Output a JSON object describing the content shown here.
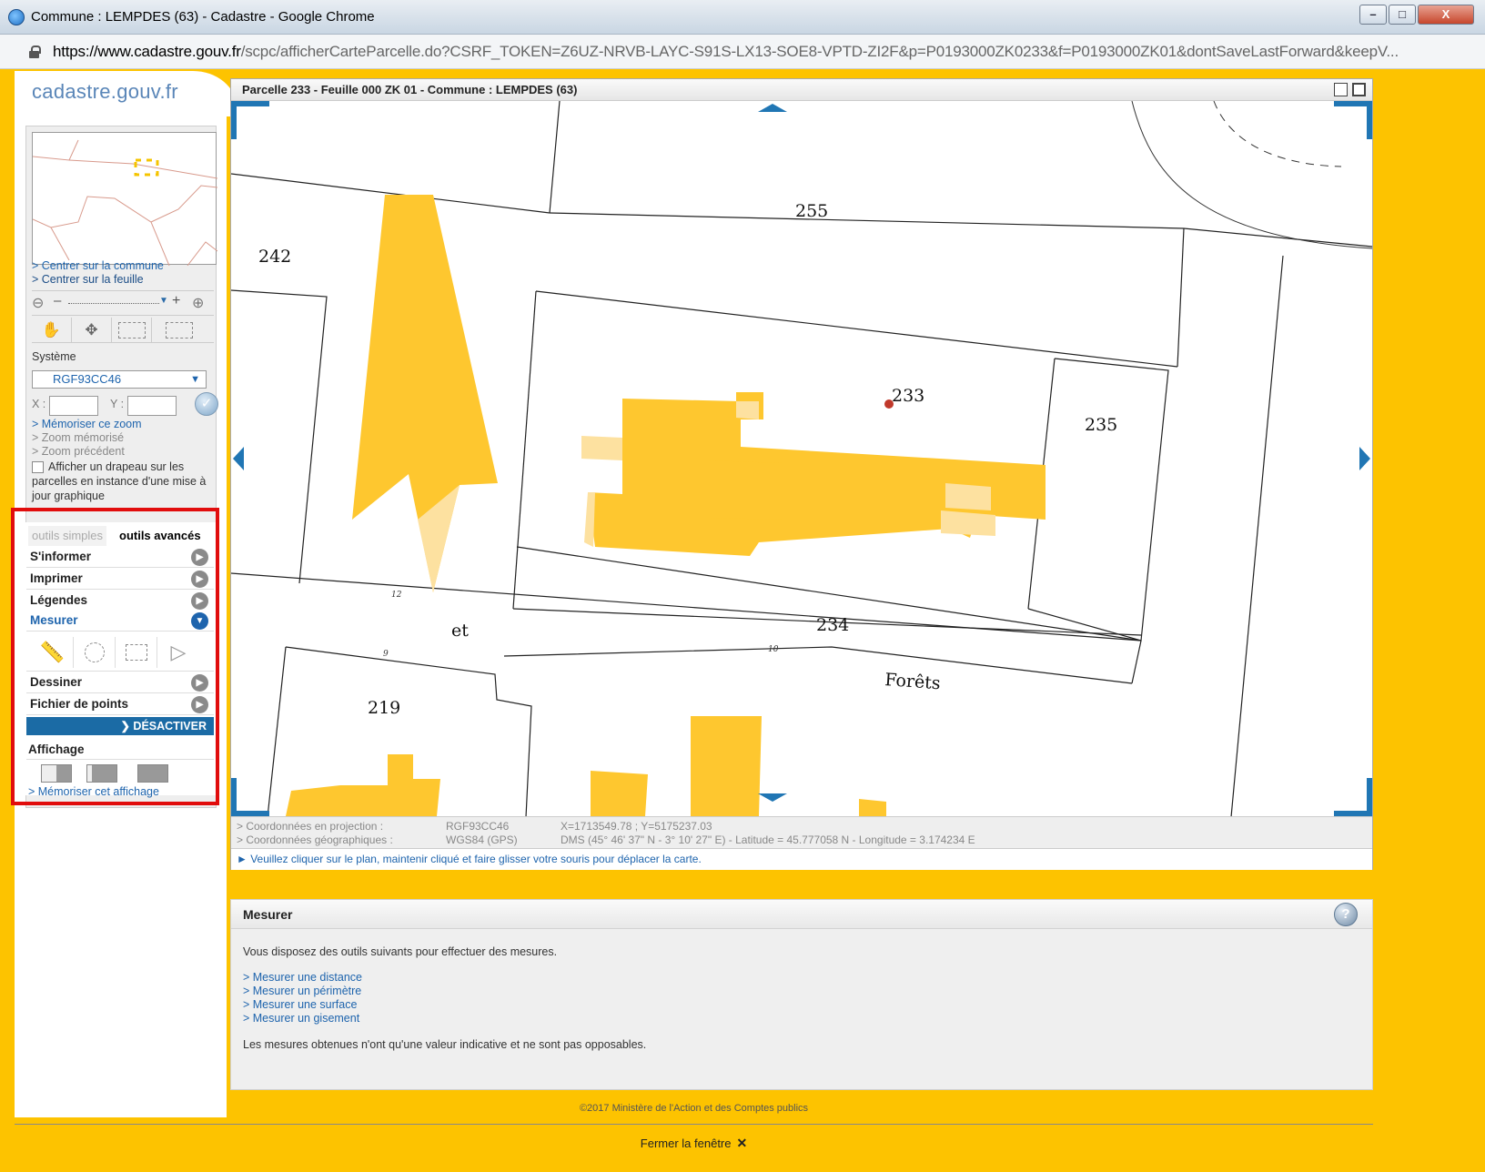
{
  "browser": {
    "title": "Commune : LEMPDES (63) - Cadastre - Google Chrome",
    "url_host": "https://www.cadastre.gouv.fr",
    "url_path": "/scpc/afficherCarteParcelle.do?CSRF_TOKEN=Z6UZ-NRVB-LAYC-S91S-LX13-SOE8-VPTD-ZI2F&p=P0193000ZK0233&f=P0193000ZK01&dontSaveLastForward&keepV...",
    "btn_min": "–",
    "btn_max": "□",
    "btn_close": "X"
  },
  "logo": "cadastre.gouv.fr",
  "sidebar": {
    "link_commune": "> Centrer sur la commune",
    "link_feuille": "> Centrer sur la feuille",
    "zoom_minus": "–",
    "zoom_plus": "+",
    "systeme_label": "Système",
    "systeme_value": "RGF93CC46",
    "x_label": "X :",
    "y_label": "Y :",
    "memoriser_zoom": "> Mémoriser ce zoom",
    "zoom_memorise": "> Zoom mémorisé",
    "zoom_precedent": "> Zoom précédent",
    "drapeau_text": "Afficher un drapeau sur les parcelles en instance d'une mise à jour graphique"
  },
  "advanced": {
    "tab_simple": "outils simples",
    "tab_advanced": "outils avancés",
    "menu": [
      {
        "label": "S'informer",
        "active": false
      },
      {
        "label": "Imprimer",
        "active": false
      },
      {
        "label": "Légendes",
        "active": false
      },
      {
        "label": "Mesurer",
        "active": true
      },
      {
        "label": "Dessiner",
        "active": false
      },
      {
        "label": "Fichier de points",
        "active": false
      }
    ],
    "desactiver": "DÉSACTIVER",
    "affichage": "Affichage",
    "memoriser_affichage": "> Mémoriser cet affichage"
  },
  "map": {
    "header_title": "Parcelle 233 - Feuille 000 ZK 01 - Commune : LEMPDES (63)",
    "labels": {
      "p255": "255",
      "p242": "242",
      "p233": "233",
      "p235": "235",
      "p234": "234",
      "p219": "219",
      "street_et": "et",
      "street_forets": "Forêts",
      "n12": "12",
      "n9": "9",
      "n10": "10"
    },
    "coord_proj_label": "> Coordonnées en projection :",
    "coord_proj_sys": "RGF93CC46",
    "coord_proj_value": "X=1713549.78 ; Y=5175237.03",
    "coord_geo_label": "> Coordonnées géographiques :",
    "coord_geo_sys": "WGS84 (GPS)",
    "coord_geo_value": "DMS (45° 46' 37\" N - 3° 10' 27\" E) - Latitude = 45.777058 N - Longitude = 3.174234 E",
    "hint": "► Veuillez cliquer sur le plan, maintenir cliqué et faire glisser votre souris pour déplacer la carte."
  },
  "mesurer_panel": {
    "title": "Mesurer",
    "intro": "Vous disposez des outils suivants pour effectuer des mesures.",
    "links": [
      "> Mesurer une distance",
      "> Mesurer un périmètre",
      "> Mesurer une surface",
      "> Mesurer un gisement"
    ],
    "note": "Les mesures obtenues n'ont qu'une valeur indicative et ne sont pas opposables."
  },
  "footer": {
    "copyright": "©2017 Ministère de l'Action et des Comptes publics",
    "close": "Fermer la fenêtre"
  },
  "colors": {
    "background": "#fdc300",
    "building": "#fec72f",
    "building_light": "#fde1a0",
    "link": "#1e64ad",
    "highlight": "#e10d0d"
  }
}
